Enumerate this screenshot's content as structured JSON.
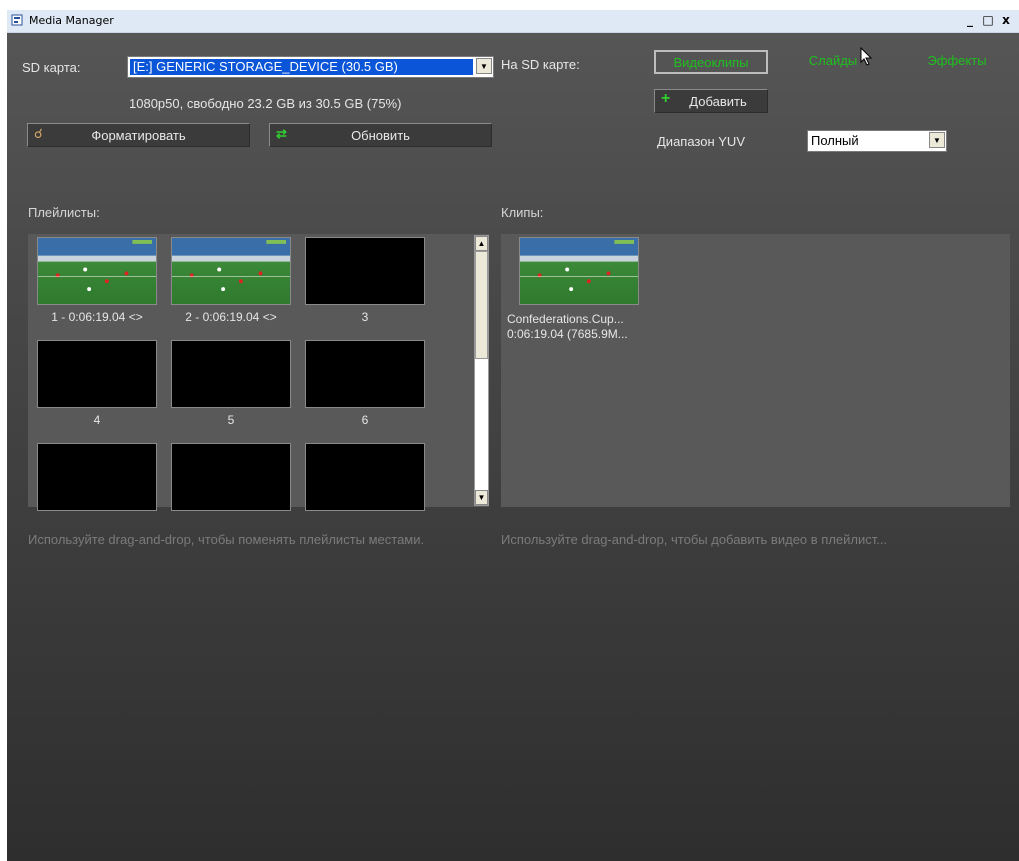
{
  "window": {
    "title": "Media Manager",
    "minimize": "_",
    "maximize": "□",
    "close": "x"
  },
  "sd": {
    "label": "SD карта:",
    "device": "[E:] GENERIC STORAGE_DEVICE (30.5 GB)",
    "info": "1080p50, свободно 23.2 GB из 30.5 GB (75%)",
    "format_label": "Форматировать",
    "refresh_label": "Обновить"
  },
  "on_card": {
    "label": "На SD карте:",
    "tabs": [
      "Видеоклипы",
      "Слайды",
      "Эффекты"
    ],
    "add_label": "Добавить",
    "yuv_label": "Диапазон YUV",
    "yuv_value": "Полный"
  },
  "playlists": {
    "label": "Плейлисты:",
    "items": [
      {
        "caption": "1 - 0:06:19.04 <>",
        "has_image": true
      },
      {
        "caption": "2 - 0:06:19.04 <>",
        "has_image": true
      },
      {
        "caption": "3",
        "has_image": false
      },
      {
        "caption": "4",
        "has_image": false
      },
      {
        "caption": "5",
        "has_image": false
      },
      {
        "caption": "6",
        "has_image": false
      },
      {
        "caption": "",
        "has_image": false
      },
      {
        "caption": "",
        "has_image": false
      },
      {
        "caption": "",
        "has_image": false
      }
    ],
    "hint": "Используйте drag-and-drop, чтобы поменять плейлисты местами."
  },
  "clips": {
    "label": "Клипы:",
    "items": [
      {
        "line1": "Confederations.Cup...",
        "line2": "0:06:19.04 (7685.9M..."
      }
    ],
    "hint": "Используйте drag-and-drop, чтобы добавить видео в плейлист..."
  },
  "colors": {
    "accent_green": "#1fbf1f",
    "selection_blue": "#0a55d8"
  }
}
